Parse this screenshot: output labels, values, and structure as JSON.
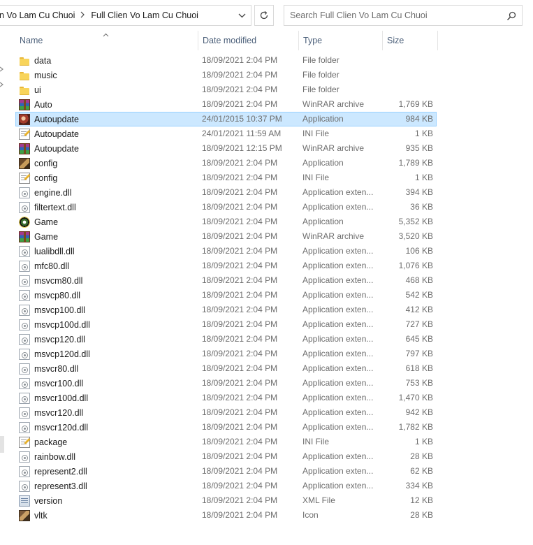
{
  "address": {
    "crumbs": [
      "n Vo Lam Cu Chuoi",
      "Full Clien Vo Lam Cu Chuoi"
    ]
  },
  "search": {
    "placeholder": "Search Full Clien Vo Lam Cu Chuoi"
  },
  "columns": {
    "name": "Name",
    "date": "Date modified",
    "type": "Type",
    "size": "Size"
  },
  "files": [
    {
      "name": "data",
      "date": "18/09/2021 2:04 PM",
      "type": "File folder",
      "size": "",
      "icon": "folder-icon"
    },
    {
      "name": "music",
      "date": "18/09/2021 2:04 PM",
      "type": "File folder",
      "size": "",
      "icon": "folder-icon"
    },
    {
      "name": "ui",
      "date": "18/09/2021 2:04 PM",
      "type": "File folder",
      "size": "",
      "icon": "folder-icon"
    },
    {
      "name": "Auto",
      "date": "18/09/2021 2:04 PM",
      "type": "WinRAR archive",
      "size": "1,769 KB",
      "icon": "winrar-icon"
    },
    {
      "name": "Autoupdate",
      "date": "24/01/2015 10:37 PM",
      "type": "Application",
      "size": "984 KB",
      "icon": "application-icon",
      "selected": true
    },
    {
      "name": "Autoupdate",
      "date": "24/01/2021 11:59 AM",
      "type": "INI File",
      "size": "1 KB",
      "icon": "ini-file-icon"
    },
    {
      "name": "Autoupdate",
      "date": "18/09/2021 12:15 PM",
      "type": "WinRAR archive",
      "size": "935 KB",
      "icon": "winrar-icon"
    },
    {
      "name": "config",
      "date": "18/09/2021 2:04 PM",
      "type": "Application",
      "size": "1,789 KB",
      "icon": "application-icon"
    },
    {
      "name": "config",
      "date": "18/09/2021 2:04 PM",
      "type": "INI File",
      "size": "1 KB",
      "icon": "ini-file-icon"
    },
    {
      "name": "engine.dll",
      "date": "18/09/2021 2:04 PM",
      "type": "Application exten...",
      "size": "394 KB",
      "icon": "dll-icon"
    },
    {
      "name": "filtertext.dll",
      "date": "18/09/2021 2:04 PM",
      "type": "Application exten...",
      "size": "36 KB",
      "icon": "dll-icon"
    },
    {
      "name": "Game",
      "date": "18/09/2021 2:04 PM",
      "type": "Application",
      "size": "5,352 KB",
      "icon": "application-icon"
    },
    {
      "name": "Game",
      "date": "18/09/2021 2:04 PM",
      "type": "WinRAR archive",
      "size": "3,520 KB",
      "icon": "winrar-icon"
    },
    {
      "name": "lualibdll.dll",
      "date": "18/09/2021 2:04 PM",
      "type": "Application exten...",
      "size": "106 KB",
      "icon": "dll-icon"
    },
    {
      "name": "mfc80.dll",
      "date": "18/09/2021 2:04 PM",
      "type": "Application exten...",
      "size": "1,076 KB",
      "icon": "dll-icon"
    },
    {
      "name": "msvcm80.dll",
      "date": "18/09/2021 2:04 PM",
      "type": "Application exten...",
      "size": "468 KB",
      "icon": "dll-icon"
    },
    {
      "name": "msvcp80.dll",
      "date": "18/09/2021 2:04 PM",
      "type": "Application exten...",
      "size": "542 KB",
      "icon": "dll-icon"
    },
    {
      "name": "msvcp100.dll",
      "date": "18/09/2021 2:04 PM",
      "type": "Application exten...",
      "size": "412 KB",
      "icon": "dll-icon"
    },
    {
      "name": "msvcp100d.dll",
      "date": "18/09/2021 2:04 PM",
      "type": "Application exten...",
      "size": "727 KB",
      "icon": "dll-icon"
    },
    {
      "name": "msvcp120.dll",
      "date": "18/09/2021 2:04 PM",
      "type": "Application exten...",
      "size": "645 KB",
      "icon": "dll-icon"
    },
    {
      "name": "msvcp120d.dll",
      "date": "18/09/2021 2:04 PM",
      "type": "Application exten...",
      "size": "797 KB",
      "icon": "dll-icon"
    },
    {
      "name": "msvcr80.dll",
      "date": "18/09/2021 2:04 PM",
      "type": "Application exten...",
      "size": "618 KB",
      "icon": "dll-icon"
    },
    {
      "name": "msvcr100.dll",
      "date": "18/09/2021 2:04 PM",
      "type": "Application exten...",
      "size": "753 KB",
      "icon": "dll-icon"
    },
    {
      "name": "msvcr100d.dll",
      "date": "18/09/2021 2:04 PM",
      "type": "Application exten...",
      "size": "1,470 KB",
      "icon": "dll-icon"
    },
    {
      "name": "msvcr120.dll",
      "date": "18/09/2021 2:04 PM",
      "type": "Application exten...",
      "size": "942 KB",
      "icon": "dll-icon"
    },
    {
      "name": "msvcr120d.dll",
      "date": "18/09/2021 2:04 PM",
      "type": "Application exten...",
      "size": "1,782 KB",
      "icon": "dll-icon"
    },
    {
      "name": "package",
      "date": "18/09/2021 2:04 PM",
      "type": "INI File",
      "size": "1 KB",
      "icon": "ini-file-icon"
    },
    {
      "name": "rainbow.dll",
      "date": "18/09/2021 2:04 PM",
      "type": "Application exten...",
      "size": "28 KB",
      "icon": "dll-icon"
    },
    {
      "name": "represent2.dll",
      "date": "18/09/2021 2:04 PM",
      "type": "Application exten...",
      "size": "62 KB",
      "icon": "dll-icon"
    },
    {
      "name": "represent3.dll",
      "date": "18/09/2021 2:04 PM",
      "type": "Application exten...",
      "size": "334 KB",
      "icon": "dll-icon"
    },
    {
      "name": "version",
      "date": "18/09/2021 2:04 PM",
      "type": "XML File",
      "size": "12 KB",
      "icon": "xml-file-icon"
    },
    {
      "name": "vltk",
      "date": "18/09/2021 2:04 PM",
      "type": "Icon",
      "size": "28 KB",
      "icon": "icon-file-icon"
    }
  ],
  "colors": {
    "selection_bg": "#cce8ff",
    "selection_border": "#99d1ff",
    "header_text": "#4c607a",
    "meta_text": "#6d6d6d"
  }
}
